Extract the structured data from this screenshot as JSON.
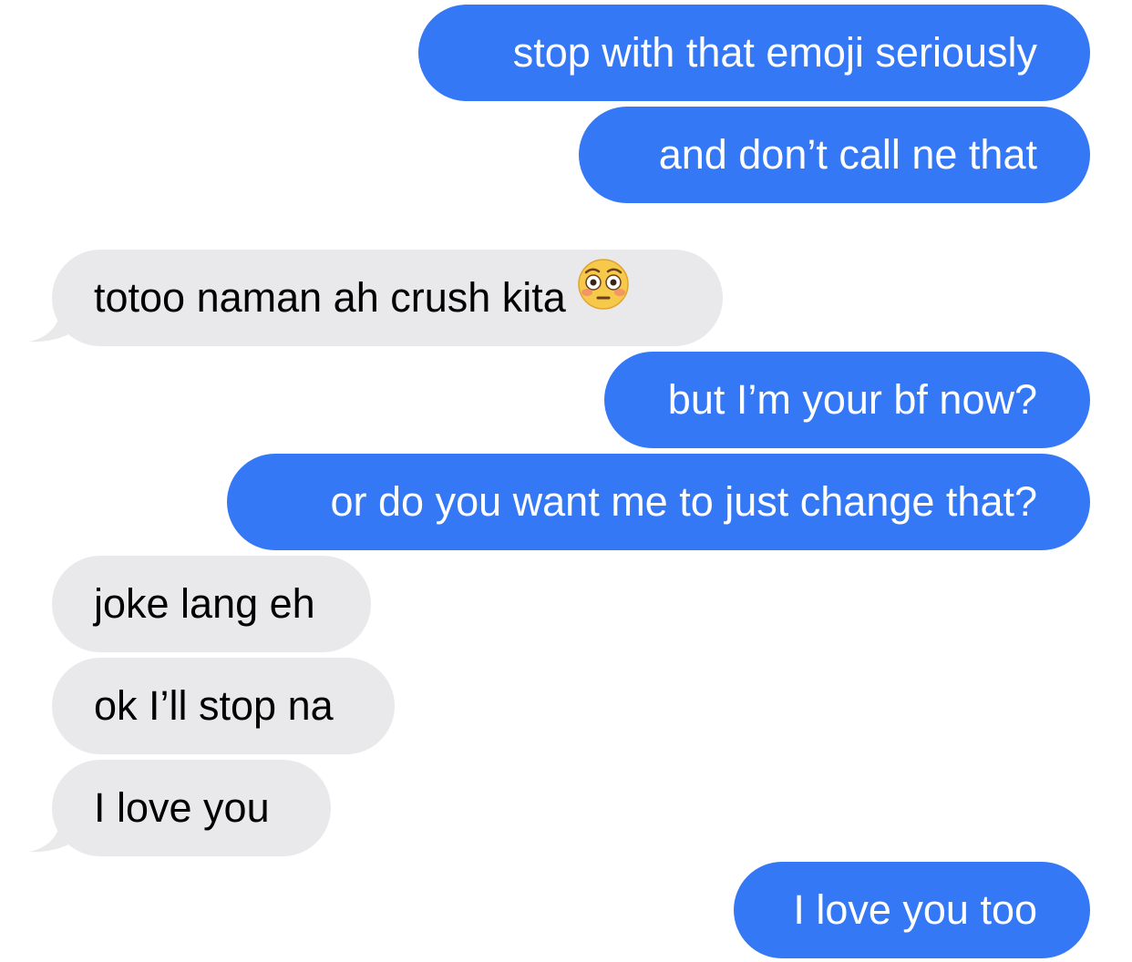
{
  "conversation": {
    "messages": [
      {
        "from": "me",
        "text": "stop with that emoji seriously"
      },
      {
        "from": "me",
        "text": "and don’t call ne that"
      },
      {
        "from": "them",
        "text": "totoo naman ah crush kita",
        "emoji": "flushed-face-emoji"
      },
      {
        "from": "me",
        "text": "but I’m your bf now?"
      },
      {
        "from": "me",
        "text": "or do you want me to just change that?"
      },
      {
        "from": "them",
        "text": "joke lang eh"
      },
      {
        "from": "them",
        "text": "ok I’ll stop na"
      },
      {
        "from": "them",
        "text": "I love you"
      },
      {
        "from": "me",
        "text": "I love you too"
      }
    ]
  },
  "colors": {
    "sent_bubble": "#3478f6",
    "received_bubble": "#e9e9eb",
    "sent_text": "#ffffff",
    "received_text": "#000000"
  }
}
